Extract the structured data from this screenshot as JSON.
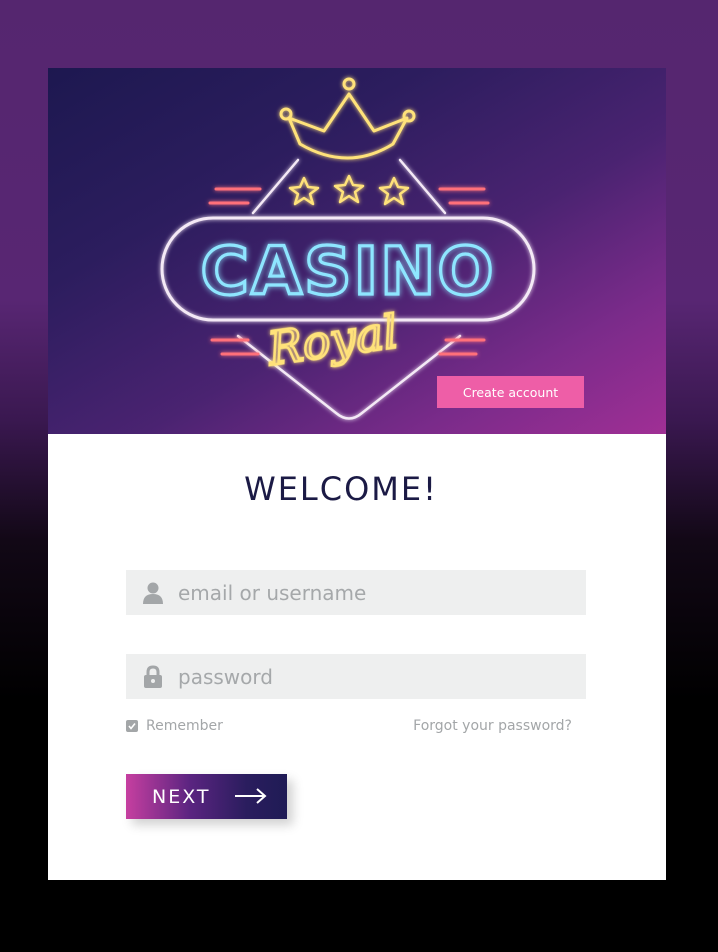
{
  "brand": {
    "title_main": "CASINO",
    "title_script": "Royal"
  },
  "header": {
    "create_account_label": "Create account"
  },
  "main": {
    "welcome_title": "WELCOME!"
  },
  "form": {
    "email": {
      "value": "",
      "placeholder": "email or username",
      "icon": "user-icon"
    },
    "password": {
      "value": "",
      "placeholder": "password",
      "icon": "lock-icon"
    },
    "remember": {
      "label": "Remember",
      "checked": true
    },
    "forgot_label": "Forgot your password?",
    "next_label": "NEXT"
  },
  "colors": {
    "accent_pink": "#ee5ea7",
    "heading_navy": "#1b1a45",
    "field_bg": "#eeefef",
    "muted_text": "#a3a6a8",
    "neon_blue": "#8ee6ff",
    "neon_yellow": "#ffe27a",
    "neon_red": "#ff6f7a"
  }
}
